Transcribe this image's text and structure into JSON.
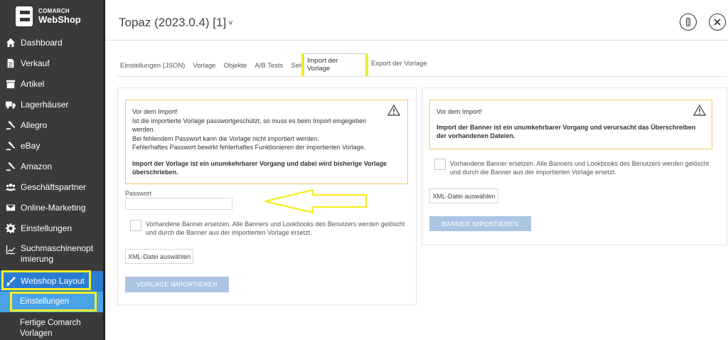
{
  "brand": {
    "line1": "COMARCH",
    "line2": "WebShop"
  },
  "sidebar": {
    "items": [
      {
        "label": "Dashboard",
        "icon": "home-icon"
      },
      {
        "label": "Verkauf",
        "icon": "document-icon"
      },
      {
        "label": "Artikel",
        "icon": "box-icon"
      },
      {
        "label": "Lagerhäuser",
        "icon": "truck-icon"
      },
      {
        "label": "Allegro",
        "icon": "gavel-icon"
      },
      {
        "label": "eBay",
        "icon": "gavel-icon"
      },
      {
        "label": "Amazon",
        "icon": "gavel-icon"
      },
      {
        "label": "Geschäftspartner",
        "icon": "users-icon"
      },
      {
        "label": "Online-Marketing",
        "icon": "envelope-icon"
      },
      {
        "label": "Einstellungen",
        "icon": "gear-icon"
      },
      {
        "label": "Suchmaschinenopt imierung",
        "icon": "chart-line-icon"
      },
      {
        "label": "Webshop Layout",
        "icon": "brush-icon"
      }
    ],
    "sub_items": [
      {
        "label": "Einstellungen"
      },
      {
        "label": "Fertige Comarch Vorlagen"
      }
    ]
  },
  "header": {
    "title": "Topaz (2023.0.4) [1]",
    "chevron": "˅"
  },
  "tabs": [
    "Einstellungen (JSON)",
    "Vorlage",
    "Objekte",
    "A/B Tests",
    "Seiten"
  ],
  "tab_active": "Import der Vorlage",
  "tab_export": "Export der Vorlage",
  "left_panel": {
    "warning": {
      "title": "Vor dem Import!",
      "lines": [
        "Ist die importierte Vorlage passwortgeschützt, so muss es beim Import eingegeben",
        "werden.",
        "Bei fehlendem Passwort kann die Vorlage nicht importiert werden.",
        "Fehlerhaftes Passwort bewirkt fehlerhaftes Funktionieren der importierten Vorlage."
      ],
      "bold_lines": [
        "Import der Vorlage ist ein unumkehrbarer Vorgang und dabei wird bisherige Vorlage",
        "überschrieben."
      ]
    },
    "password_label": "Passwort",
    "password_value": "",
    "checkbox_lines": [
      "Vorhandene Banner ersetzen. Alle Banners und Lookbooks des Benutzers werden gelöscht",
      "und durch die Banner aus der importierten Vorlage ersetzt."
    ],
    "file_button": "XML-Datei auswählen",
    "import_button": "VORLAGE IMPORTIEREN"
  },
  "right_panel": {
    "warning": {
      "title": "Vor dem Import!",
      "bold_lines": [
        "Import der Banner ist ein unumkehrbarer Vorgang und verursacht das Überschreiben",
        "der vorhandenen Dateien."
      ]
    },
    "checkbox_lines": [
      "Vorhandene Banner ersetzen. Alle Banners und Lookbooks des Benutzers werden gelöscht",
      "und durch die Banner aus der importierten Vorlage ersetzt."
    ],
    "file_button": "XML-Datei auswählen",
    "import_button": "BANNER IMPORTIEREN"
  },
  "colors": {
    "sidebar": "#3a3a3a",
    "active": "#2b7cd3",
    "highlight": "#f5ef20",
    "warning_border": "#f2c46d",
    "primary_button": "#aac4e3"
  }
}
